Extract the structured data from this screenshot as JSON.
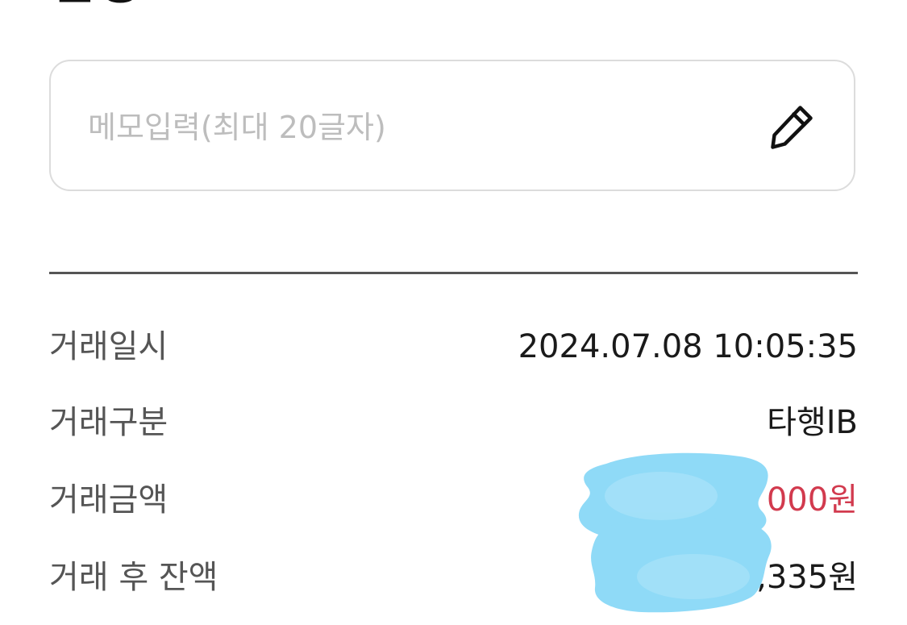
{
  "header": {
    "title_fragment": "신청"
  },
  "memo": {
    "placeholder": "메모입력(최대 20글자)",
    "value": "",
    "edit_icon": "pencil-icon"
  },
  "details": {
    "rows": [
      {
        "label": "거래일시",
        "value": "2024.07.08 10:05:35"
      },
      {
        "label": "거래구분",
        "value": "타행IB"
      },
      {
        "label": "거래금액",
        "value": "000원",
        "redacted": true
      },
      {
        "label": "거래 후 잔액",
        "value": ",335원",
        "redacted": true
      }
    ]
  },
  "colors": {
    "amount": "#d23a4e",
    "label": "#555555",
    "value": "#1a1a1a",
    "placeholder": "#bdbdbd",
    "border": "#dcdcdc",
    "divider": "#555555",
    "redaction": "#8fdaf7"
  }
}
